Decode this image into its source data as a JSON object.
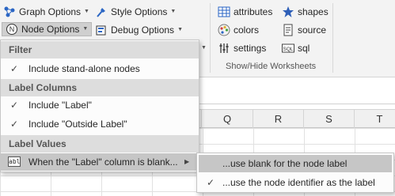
{
  "ribbon": {
    "graph_options": "Graph Options",
    "style_options": "Style Options",
    "node_options": "Node Options",
    "debug_options": "Debug Options",
    "attributes": "attributes",
    "shapes": "shapes",
    "colors": "colors",
    "source": "source",
    "settings": "settings",
    "sql": "sql",
    "group_label": "Show/Hide Worksheets"
  },
  "columns": [
    "Q",
    "R",
    "S",
    "T"
  ],
  "menu": {
    "filter_header": "Filter",
    "include_standalone": "Include stand-alone nodes",
    "label_columns_header": "Label Columns",
    "include_label": "Include \"Label\"",
    "include_outside_label": "Include \"Outside Label\"",
    "label_values_header": "Label Values",
    "blank_item": "When the \"Label\" column is blank...",
    "blank_item_icon": "abl"
  },
  "submenu": {
    "use_blank": "...use blank for the node label",
    "use_identifier": "...use the node identifier as the label"
  },
  "colors": {
    "accent_blue": "#2b66c4",
    "star_blue": "#2e5fb8",
    "highlight": "#c6c6c6"
  }
}
